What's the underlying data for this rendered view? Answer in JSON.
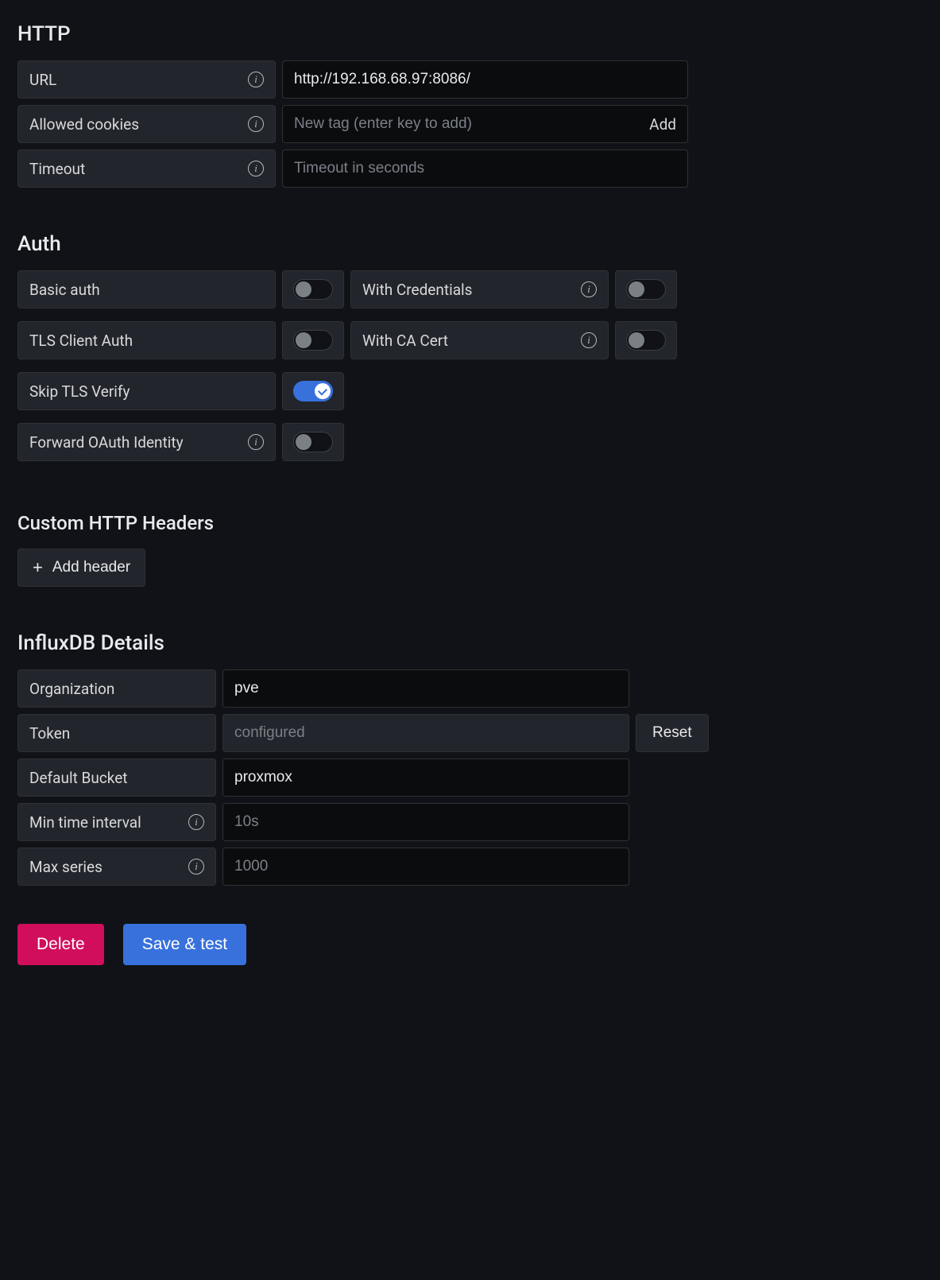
{
  "http": {
    "title": "HTTP",
    "url_label": "URL",
    "url_value": "http://192.168.68.97:8086/",
    "cookies_label": "Allowed cookies",
    "cookies_placeholder": "New tag (enter key to add)",
    "cookies_add": "Add",
    "timeout_label": "Timeout",
    "timeout_placeholder": "Timeout in seconds"
  },
  "auth": {
    "title": "Auth",
    "basic_auth_label": "Basic auth",
    "basic_auth_on": false,
    "with_credentials_label": "With Credentials",
    "with_credentials_on": false,
    "tls_client_label": "TLS Client Auth",
    "tls_client_on": false,
    "with_ca_label": "With CA Cert",
    "with_ca_on": false,
    "skip_tls_label": "Skip TLS Verify",
    "skip_tls_on": true,
    "forward_oauth_label": "Forward OAuth Identity",
    "forward_oauth_on": false
  },
  "headers": {
    "title": "Custom HTTP Headers",
    "add_label": "Add header"
  },
  "influx": {
    "title": "InfluxDB Details",
    "org_label": "Organization",
    "org_value": "pve",
    "token_label": "Token",
    "token_placeholder": "configured",
    "reset_label": "Reset",
    "bucket_label": "Default Bucket",
    "bucket_value": "proxmox",
    "min_interval_label": "Min time interval",
    "min_interval_placeholder": "10s",
    "max_series_label": "Max series",
    "max_series_placeholder": "1000"
  },
  "actions": {
    "delete": "Delete",
    "save": "Save & test"
  }
}
